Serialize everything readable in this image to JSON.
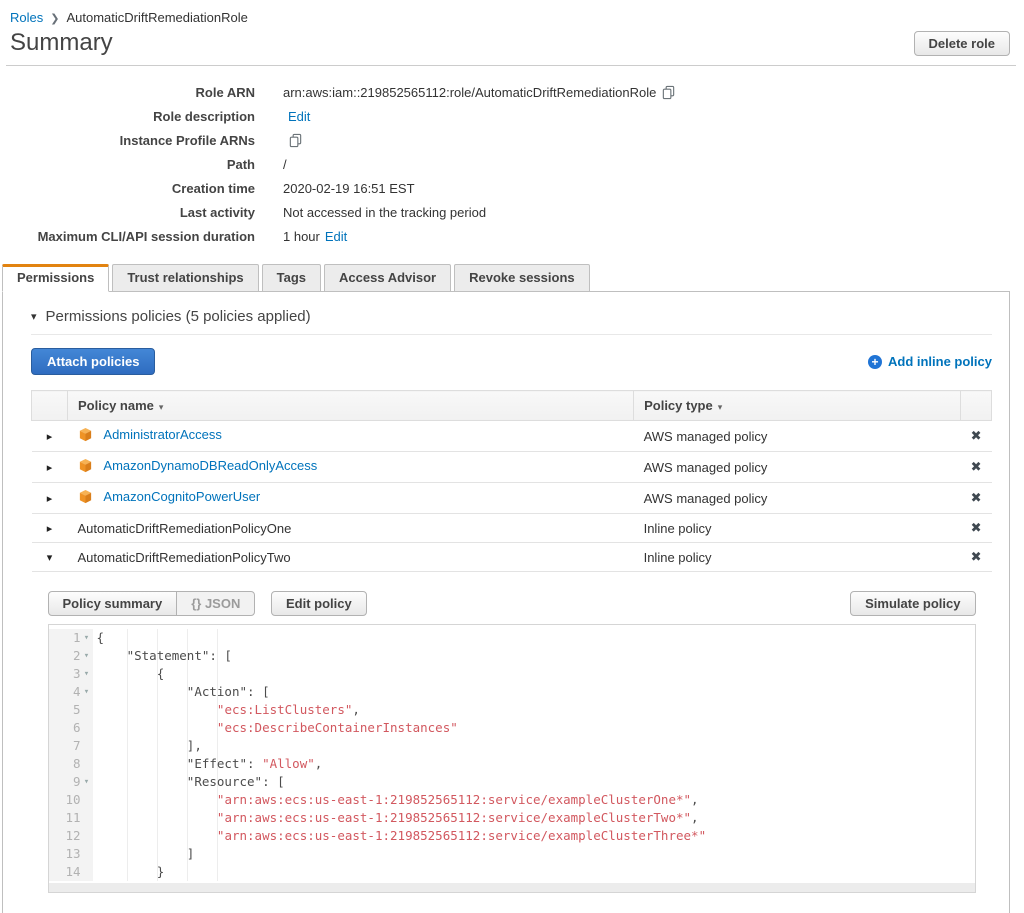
{
  "colors": {
    "link_blue": "#0073bb",
    "tab_accent_orange": "#e28310",
    "primary_button_blue": "#3b7dd8",
    "code_string_red": "#d2585f",
    "managed_policy_icon_orange": "#ef9325"
  },
  "breadcrumb": {
    "root": "Roles",
    "separator": "❯",
    "current": "AutomaticDriftRemediationRole"
  },
  "header": {
    "title": "Summary",
    "delete_button": "Delete role"
  },
  "summary_fields": [
    {
      "label": "Role ARN",
      "value": "arn:aws:iam::219852565112:role/AutomaticDriftRemediationRole",
      "copy": true
    },
    {
      "label": "Role description",
      "link": "Edit"
    },
    {
      "label": "Instance Profile ARNs",
      "copy": true
    },
    {
      "label": "Path",
      "value": "/"
    },
    {
      "label": "Creation time",
      "value": "2020-02-19 16:51 EST"
    },
    {
      "label": "Last activity",
      "value": "Not accessed in the tracking period"
    },
    {
      "label": "Maximum CLI/API session duration",
      "value": "1 hour",
      "link": "Edit"
    }
  ],
  "tabs": [
    {
      "label": "Permissions",
      "active": true
    },
    {
      "label": "Trust relationships",
      "active": false
    },
    {
      "label": "Tags",
      "active": false
    },
    {
      "label": "Access Advisor",
      "active": false
    },
    {
      "label": "Revoke sessions",
      "active": false
    }
  ],
  "permissions": {
    "section_title": "Permissions policies (5 policies applied)",
    "attach_button": "Attach policies",
    "add_inline_link": "Add inline policy",
    "table": {
      "columns": {
        "name": "Policy name",
        "type": "Policy type"
      },
      "rows": [
        {
          "name": "AdministratorAccess",
          "type": "AWS managed policy",
          "managed": true,
          "expanded": false
        },
        {
          "name": "AmazonDynamoDBReadOnlyAccess",
          "type": "AWS managed policy",
          "managed": true,
          "expanded": false
        },
        {
          "name": "AmazonCognitoPowerUser",
          "type": "AWS managed policy",
          "managed": true,
          "expanded": false
        },
        {
          "name": "AutomaticDriftRemediationPolicyOne",
          "type": "Inline policy",
          "managed": false,
          "expanded": false
        },
        {
          "name": "AutomaticDriftRemediationPolicyTwo",
          "type": "Inline policy",
          "managed": false,
          "expanded": true
        }
      ]
    },
    "detail": {
      "summary_button": "Policy summary",
      "json_button": "{} JSON",
      "edit_button": "Edit policy",
      "simulate_button": "Simulate policy",
      "code_lines": [
        {
          "n": 1,
          "fold": true,
          "seg": [
            {
              "t": "{",
              "k": "p"
            }
          ]
        },
        {
          "n": 2,
          "fold": true,
          "seg": [
            {
              "t": "    \"Statement\": [",
              "k": "p"
            }
          ]
        },
        {
          "n": 3,
          "fold": true,
          "seg": [
            {
              "t": "        {",
              "k": "p"
            }
          ]
        },
        {
          "n": 4,
          "fold": true,
          "seg": [
            {
              "t": "            \"Action\": [",
              "k": "p"
            }
          ]
        },
        {
          "n": 5,
          "fold": false,
          "seg": [
            {
              "t": "                ",
              "k": "p"
            },
            {
              "t": "\"ecs:ListClusters\"",
              "k": "s"
            },
            {
              "t": ",",
              "k": "p"
            }
          ]
        },
        {
          "n": 6,
          "fold": false,
          "seg": [
            {
              "t": "                ",
              "k": "p"
            },
            {
              "t": "\"ecs:DescribeContainerInstances\"",
              "k": "s"
            }
          ]
        },
        {
          "n": 7,
          "fold": false,
          "seg": [
            {
              "t": "            ],",
              "k": "p"
            }
          ]
        },
        {
          "n": 8,
          "fold": false,
          "seg": [
            {
              "t": "            \"Effect\": ",
              "k": "p"
            },
            {
              "t": "\"Allow\"",
              "k": "s"
            },
            {
              "t": ",",
              "k": "p"
            }
          ]
        },
        {
          "n": 9,
          "fold": true,
          "seg": [
            {
              "t": "            \"Resource\": [",
              "k": "p"
            }
          ]
        },
        {
          "n": 10,
          "fold": false,
          "seg": [
            {
              "t": "                ",
              "k": "p"
            },
            {
              "t": "\"arn:aws:ecs:us-east-1:219852565112:service/exampleClusterOne*\"",
              "k": "s"
            },
            {
              "t": ",",
              "k": "p"
            }
          ]
        },
        {
          "n": 11,
          "fold": false,
          "seg": [
            {
              "t": "                ",
              "k": "p"
            },
            {
              "t": "\"arn:aws:ecs:us-east-1:219852565112:service/exampleClusterTwo*\"",
              "k": "s"
            },
            {
              "t": ",",
              "k": "p"
            }
          ]
        },
        {
          "n": 12,
          "fold": false,
          "seg": [
            {
              "t": "                ",
              "k": "p"
            },
            {
              "t": "\"arn:aws:ecs:us-east-1:219852565112:service/exampleClusterThree*\"",
              "k": "s"
            }
          ]
        },
        {
          "n": 13,
          "fold": false,
          "seg": [
            {
              "t": "            ]",
              "k": "p"
            }
          ]
        },
        {
          "n": 14,
          "fold": false,
          "seg": [
            {
              "t": "        }",
              "k": "p"
            }
          ]
        }
      ]
    }
  }
}
